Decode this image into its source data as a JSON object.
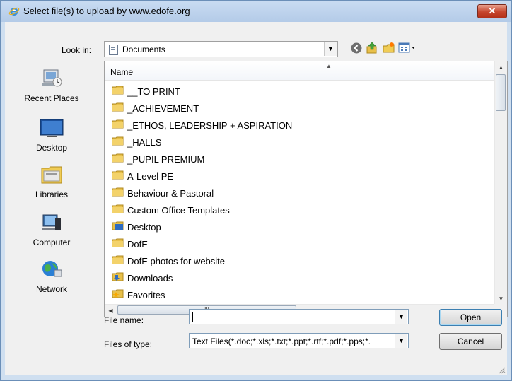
{
  "window": {
    "title": "Select file(s) to upload by www.edofe.org",
    "close_label": "✕"
  },
  "lookin": {
    "label": "Look in:",
    "value": "Documents"
  },
  "places": [
    {
      "label": "Recent Places",
      "icon": "recent-places-icon"
    },
    {
      "label": "Desktop",
      "icon": "desktop-icon"
    },
    {
      "label": "Libraries",
      "icon": "libraries-icon"
    },
    {
      "label": "Computer",
      "icon": "computer-icon"
    },
    {
      "label": "Network",
      "icon": "network-icon"
    }
  ],
  "list": {
    "column_name": "Name",
    "items": [
      {
        "label": "__TO PRINT",
        "icon": "folder-icon"
      },
      {
        "label": "_ACHIEVEMENT",
        "icon": "folder-icon"
      },
      {
        "label": "_ETHOS, LEADERSHIP + ASPIRATION",
        "icon": "folder-icon"
      },
      {
        "label": "_HALLS",
        "icon": "folder-icon"
      },
      {
        "label": "_PUPIL PREMIUM",
        "icon": "folder-icon"
      },
      {
        "label": "A-Level PE",
        "icon": "folder-icon"
      },
      {
        "label": "Behaviour & Pastoral",
        "icon": "folder-icon"
      },
      {
        "label": "Custom Office Templates",
        "icon": "folder-icon"
      },
      {
        "label": "Desktop",
        "icon": "desktop-folder-icon"
      },
      {
        "label": "DofE",
        "icon": "folder-icon"
      },
      {
        "label": "DofE photos for website",
        "icon": "folder-icon"
      },
      {
        "label": "Downloads",
        "icon": "downloads-folder-icon"
      },
      {
        "label": "Favorites",
        "icon": "favorites-folder-icon"
      }
    ],
    "hscroll_grip": "III"
  },
  "filename": {
    "label": "File name:",
    "value": ""
  },
  "filetype": {
    "label": "Files of type:",
    "value": "Text Files(*.doc;*.xls;*.txt;*.ppt;*.rtf;*.pdf;*.pps;*."
  },
  "buttons": {
    "open": "Open",
    "cancel": "Cancel"
  },
  "colors": {
    "title_bar": "#c9dcf2",
    "close_button": "#c6452d",
    "folder": "#e8c04a",
    "selection_header": "#f3f6fa"
  }
}
